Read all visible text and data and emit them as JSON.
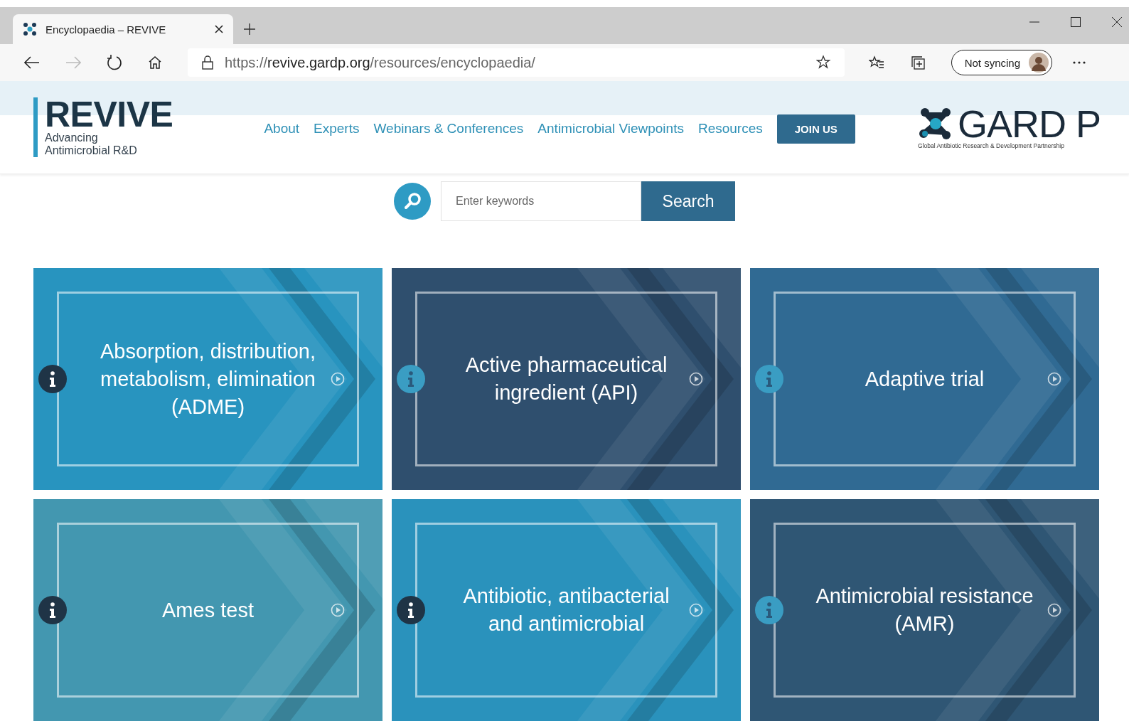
{
  "browser": {
    "tab": {
      "title": "Encyclopaedia – REVIVE",
      "selected": true
    },
    "url": {
      "scheme": "https://",
      "host": "revive.gardp.org",
      "path": "/resources/encyclopaedia/"
    },
    "profile": {
      "label": "Not syncing"
    }
  },
  "site": {
    "logo": {
      "name": "REVIVE",
      "tagline_1": "Advancing",
      "tagline_2": "Antimicrobial R&D"
    },
    "nav": [
      "About",
      "Experts",
      "Webinars & Conferences",
      "Antimicrobial Viewpoints",
      "Resources"
    ],
    "join_button": "JOIN US",
    "partner": {
      "name": "GARD P",
      "tagline": "Global Antibiotic Research & Development Partnership"
    }
  },
  "search": {
    "placeholder": "Enter keywords",
    "button": "Search"
  },
  "tiles": [
    {
      "title": "Absorption, distribution, metabolism, elimination (ADME)",
      "color": "#2894bf",
      "kind": "light"
    },
    {
      "title": "Active pharmaceutical ingredient (API)",
      "color": "#2f4f6e",
      "kind": "dark"
    },
    {
      "title": "Adaptive trial",
      "color": "#306a93",
      "kind": "dark"
    },
    {
      "title": "Ames test",
      "color": "#4397b0",
      "kind": "light"
    },
    {
      "title": "Antibiotic, antibacterial and antimicrobial",
      "color": "#2a92bc",
      "kind": "light"
    },
    {
      "title": "Antimicrobial resistance (AMR)",
      "color": "#2f5674",
      "kind": "dark"
    }
  ]
}
